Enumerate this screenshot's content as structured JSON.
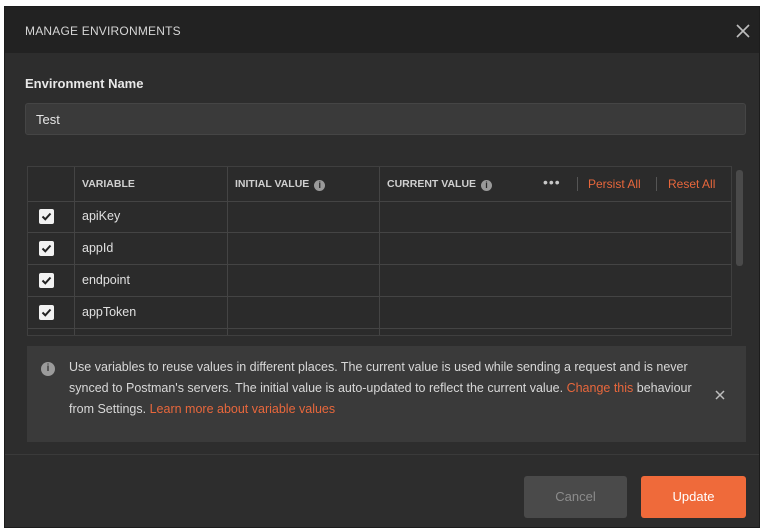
{
  "dialog": {
    "title": "MANAGE ENVIRONMENTS",
    "close_icon": "close-icon"
  },
  "environment": {
    "label": "Environment Name",
    "value": "Test"
  },
  "table": {
    "columns": {
      "variable": "VARIABLE",
      "initial_value": "INITIAL VALUE",
      "current_value": "CURRENT VALUE",
      "info_glyph": "i"
    },
    "more_icon": "more-horizontal-icon",
    "persist_all": "Persist All",
    "reset_all": "Reset All",
    "rows": [
      {
        "checked": true,
        "variable": "apiKey",
        "initial_value": "",
        "current_value": ""
      },
      {
        "checked": true,
        "variable": "appId",
        "initial_value": "",
        "current_value": ""
      },
      {
        "checked": true,
        "variable": "endpoint",
        "initial_value": "",
        "current_value": ""
      },
      {
        "checked": true,
        "variable": "appToken",
        "initial_value": "",
        "current_value": ""
      }
    ]
  },
  "notice": {
    "icon": "info-icon",
    "text_1": "Use variables to reuse values in different places. The current value is used while sending a request and is never synced to Postman's servers. The initial value is auto-updated to reflect the current value. ",
    "link_change": "Change this",
    "text_2": " behaviour from Settings. ",
    "link_learn": "Learn more about variable values"
  },
  "footer": {
    "cancel_label": "Cancel",
    "update_label": "Update"
  },
  "colors": {
    "accent": "#ef6a3a",
    "link": "#e8673c",
    "background": "#2d2d2d",
    "header": "#222222"
  }
}
